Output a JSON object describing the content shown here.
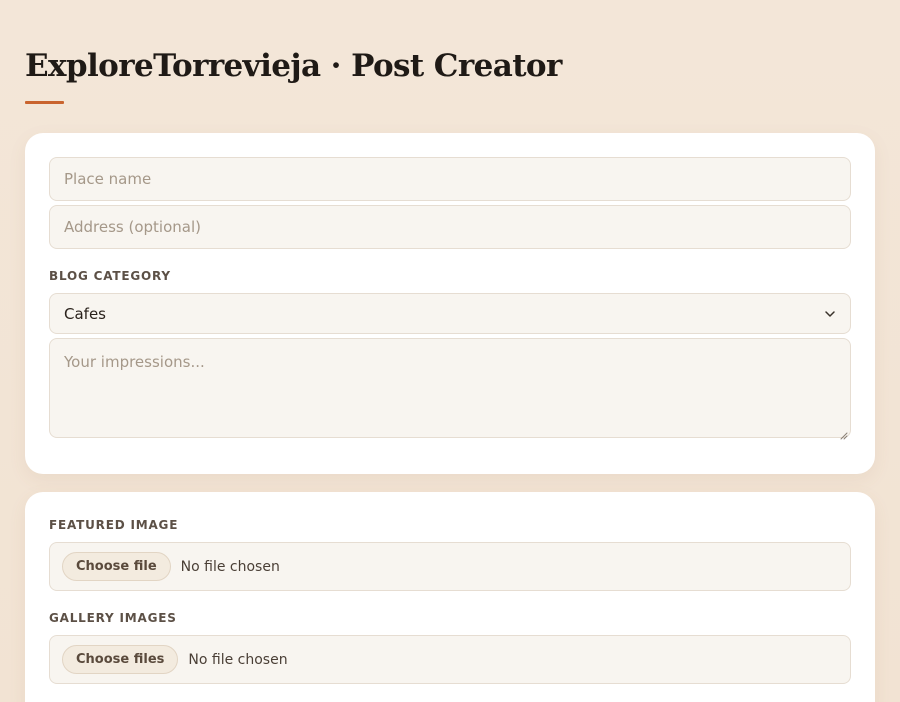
{
  "header": {
    "title": "ExploreTorrevieja · Post Creator"
  },
  "post_form": {
    "place_name_placeholder": "Place name",
    "address_placeholder": "Address (optional)",
    "category_label": "BLOG CATEGORY",
    "category_selected": "Cafes",
    "impressions_placeholder": "Your impressions..."
  },
  "media_form": {
    "featured_label": "FEATURED IMAGE",
    "featured_button": "Choose file",
    "featured_status": "No file chosen",
    "gallery_label": "GALLERY IMAGES",
    "gallery_button": "Choose files",
    "gallery_status": "No file chosen"
  },
  "colors": {
    "accent": "#c9642e",
    "background": "#f3e6d8",
    "card": "#ffffff",
    "field_bg": "#f8f5f0"
  }
}
